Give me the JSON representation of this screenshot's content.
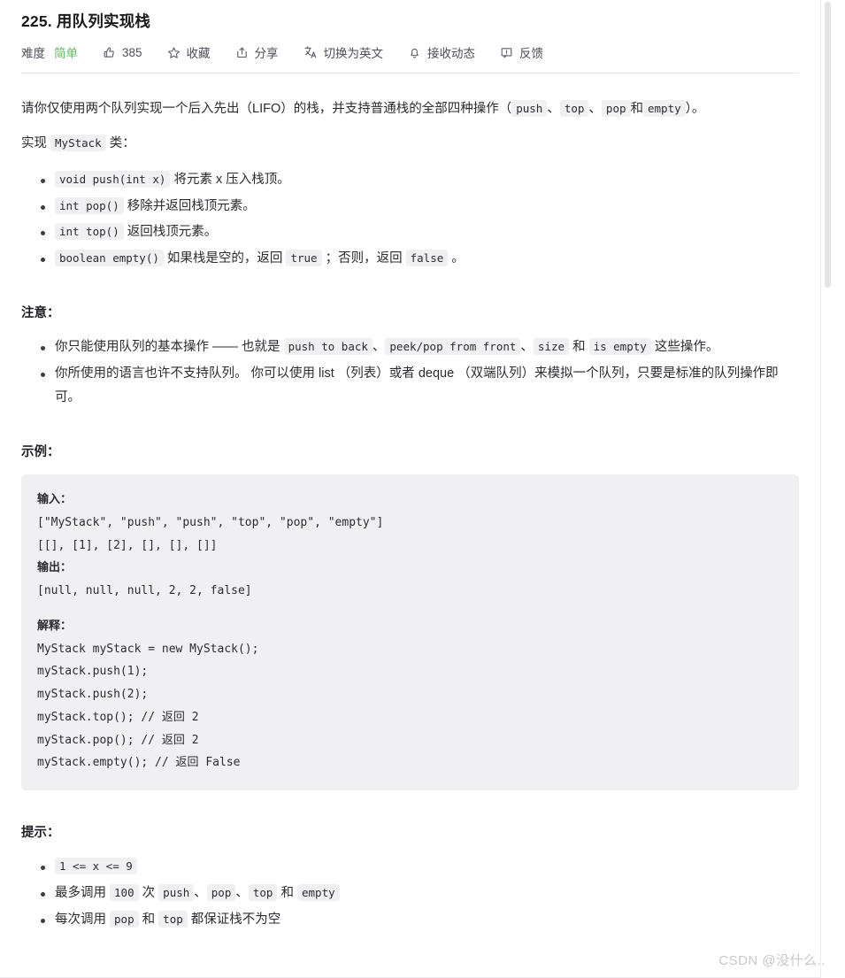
{
  "header": {
    "title": "225. 用队列实现栈",
    "difficulty_label": "难度",
    "difficulty_value": "简单",
    "likes": "385",
    "favorite": "收藏",
    "share": "分享",
    "translate": "切换为英文",
    "subscribe": "接收动态",
    "feedback": "反馈",
    "icons": {
      "like": "thumbs-up-icon",
      "favorite": "star-icon",
      "share": "share-icon",
      "translate": "translate-icon",
      "subscribe": "bell-icon",
      "feedback": "feedback-icon"
    }
  },
  "intro": {
    "p1_a": "请你仅使用两个队列实现一个后入先出（LIFO）的栈，并支持普通栈的全部四种操作（",
    "p1_c1": "push",
    "p1_b": "、",
    "p1_c2": "top",
    "p1_c": "、",
    "p1_c3": "pop",
    "p1_d": "和",
    "p1_c4": "empty",
    "p1_e": "）。",
    "p2_a": "实现",
    "p2_code": "MyStack",
    "p2_b": "类："
  },
  "methods": [
    {
      "code": "void push(int x)",
      "text": "将元素 x 压入栈顶。"
    },
    {
      "code": "int pop()",
      "text": "移除并返回栈顶元素。"
    },
    {
      "code": "int top()",
      "text": "返回栈顶元素。"
    },
    {
      "code": "boolean empty()",
      "text_a": "如果栈是空的，返回",
      "code_b": "true",
      "text_b": "；否则，返回",
      "code_c": "false",
      "text_c": "。"
    }
  ],
  "notes": {
    "heading": "注意：",
    "item1_a": "你只能使用队列的基本操作 —— 也就是",
    "item1_c1": "push to back",
    "item1_b": "、",
    "item1_c2": "peek/pop from front",
    "item1_c": "、",
    "item1_c3": "size",
    "item1_d": "和",
    "item1_c4": "is empty",
    "item1_e": "这些操作。",
    "item2": "你所使用的语言也许不支持队列。 你可以使用 list （列表）或者 deque （双端队列）来模拟一个队列，只要是标准的队列操作即可。"
  },
  "example": {
    "heading": "示例：",
    "input_label": "输入：",
    "input_line1": "[\"MyStack\", \"push\", \"push\", \"top\", \"pop\", \"empty\"]",
    "input_line2": "[[], [1], [2], [], [], []]",
    "output_label": "输出：",
    "output_line": "[null, null, null, 2, 2, false]",
    "explain_label": "解释：",
    "explain_lines": [
      "MyStack myStack = new MyStack();",
      "myStack.push(1);",
      "myStack.push(2);",
      "myStack.top(); // 返回 2",
      "myStack.pop(); // 返回 2",
      "myStack.empty(); // 返回 False"
    ]
  },
  "hints": {
    "heading": "提示：",
    "item1_code": "1 <= x <= 9",
    "item2_a": "最多调用",
    "item2_c0": "100",
    "item2_b": "次",
    "item2_c1": "push",
    "item2_sep1": "、",
    "item2_c2": "pop",
    "item2_sep2": "、",
    "item2_c3": "top",
    "item2_c": "和",
    "item2_c4": "empty",
    "item3_a": "每次调用",
    "item3_c1": "pop",
    "item3_b": "和",
    "item3_c2": "top",
    "item3_c": "都保证栈不为空"
  },
  "watermark": "CSDN @没什么.."
}
